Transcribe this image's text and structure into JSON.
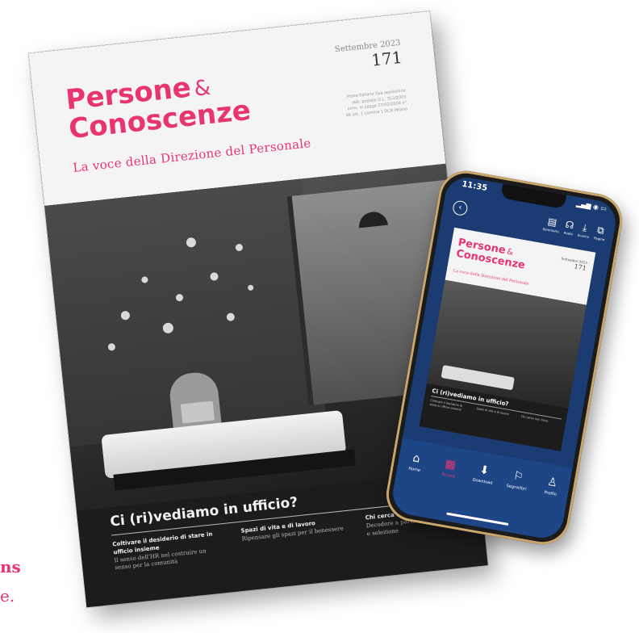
{
  "magazine": {
    "brand_line1": "Persone",
    "brand_amp": "&",
    "brand_line2": "Conoscenze",
    "tagline": "La voce della Direzione del Personale",
    "issue_month": "Settembre 2023",
    "issue_number": "171",
    "postal_note": "Poste Italiane Spa spedizione abb. postale D.L. 353/2003 conv. in Legge 27/02/2004 n° 46 art. 1 comma 1 DCB Milano",
    "headline": "Ci (ri)vediamo in ufficio?",
    "columns": [
      {
        "title": "Coltivare il desiderio di stare in ufficio insieme",
        "body": "Il senso dell'HR nel costruire un senso per la comunità"
      },
      {
        "title": "Spazi di vita e di lavoro",
        "body": "Ripensare gli spazi per il benessere"
      },
      {
        "title": "Chi cerca non trova",
        "body": "Decodere a partire dalla ricerca e selezione"
      }
    ]
  },
  "left_crop": {
    "line1": "ns",
    "line2": "e."
  },
  "phone": {
    "time": "11:35",
    "status_icons": "▂▄▆ ◉ ▭",
    "back_icon": "‹",
    "toolbar": [
      {
        "icon": "▤",
        "label": "Sommario"
      },
      {
        "icon": "☊",
        "label": "Audio"
      },
      {
        "icon": "⤓",
        "label": "Scarica"
      },
      {
        "icon": "⧉",
        "label": "Pagine"
      }
    ],
    "cover": {
      "brand_line1": "Persone",
      "brand_amp": "&",
      "brand_line2": "Conoscenze",
      "tagline": "La voce della Direzione del Personale",
      "issue_month": "Settembre 2023",
      "issue_number": "171",
      "headline": "Ci (ri)vediamo in ufficio?",
      "col1": "Coltivare il desiderio di stare in ufficio insieme",
      "col2": "Spazi di vita e di lavoro",
      "col3": "Chi cerca non trova"
    },
    "tabs": [
      {
        "icon": "⌂",
        "label": "Home"
      },
      {
        "icon": "▦",
        "label": "Riviste"
      },
      {
        "icon": "⬇",
        "label": "Download"
      },
      {
        "icon": "⚐",
        "label": "Segnalibri"
      },
      {
        "icon": "♙",
        "label": "Profilo"
      }
    ],
    "active_tab": "Riviste"
  },
  "colors": {
    "brand": "#e8356e",
    "app_blue": "#1a3c73"
  }
}
